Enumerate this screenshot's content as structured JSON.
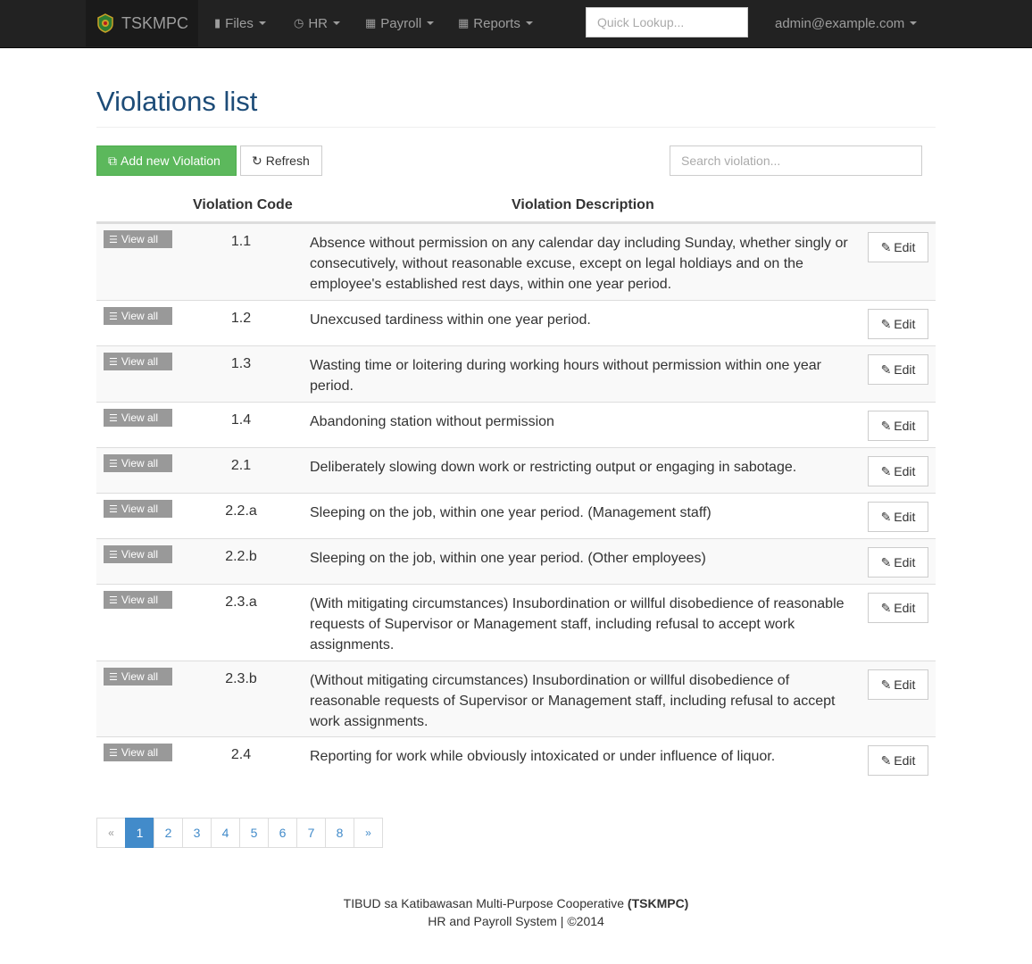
{
  "navbar": {
    "brand": "TSKMPC",
    "menus": [
      {
        "label": "Files",
        "icon": "book-icon"
      },
      {
        "label": "HR",
        "icon": "clock-icon"
      },
      {
        "label": "Payroll",
        "icon": "calculator-icon"
      },
      {
        "label": "Reports",
        "icon": "calculator-icon"
      }
    ],
    "quick_lookup_placeholder": "Quick Lookup...",
    "user": "admin@example.com"
  },
  "page": {
    "title": "Violations list",
    "add_button": "Add new Violation",
    "refresh_button": "Refresh",
    "search_placeholder": "Search violation..."
  },
  "table": {
    "headers": {
      "code": "Violation Code",
      "description": "Violation Description"
    },
    "view_all_label": "View all",
    "edit_label": "Edit",
    "rows": [
      {
        "code": "1.1",
        "description": "Absence without permission on any calendar day including Sunday, whether singly or consecutively, without reasonable excuse, except on legal holdiays and on the employee's established rest days, within one year period."
      },
      {
        "code": "1.2",
        "description": "Unexcused tardiness within one year period."
      },
      {
        "code": "1.3",
        "description": "Wasting time or loitering during working hours without permission within one year period."
      },
      {
        "code": "1.4",
        "description": "Abandoning station without permission"
      },
      {
        "code": "2.1",
        "description": "Deliberately slowing down work or restricting output or engaging in sabotage."
      },
      {
        "code": "2.2.a",
        "description": "Sleeping on the job, within one year period. (Management staff)"
      },
      {
        "code": "2.2.b",
        "description": "Sleeping on the job, within one year period. (Other employees)"
      },
      {
        "code": "2.3.a",
        "description": "(With mitigating circumstances) Insubordination or willful disobedience of reasonable requests of Supervisor or Management staff, including refusal to accept work assignments."
      },
      {
        "code": "2.3.b",
        "description": "(Without mitigating circumstances) Insubordination or willful disobedience of reasonable requests of Supervisor or Management staff, including refusal to accept work assignments."
      },
      {
        "code": "2.4",
        "description": "Reporting for work while obviously intoxicated or under influence of liquor."
      }
    ]
  },
  "pagination": {
    "prev": "«",
    "pages": [
      "1",
      "2",
      "3",
      "4",
      "5",
      "6",
      "7",
      "8"
    ],
    "active": "1",
    "next": "»"
  },
  "footer": {
    "line1_text": "TIBUD sa Katibawasan Multi-Purpose Cooperative",
    "line1_bold": "(TSKMPC)",
    "line2": "HR and Payroll System | ©2014"
  },
  "colors": {
    "navbar": "#222222",
    "title": "#1d4c78",
    "add_button": "#5cb85c",
    "pagination_active": "#428bca"
  }
}
